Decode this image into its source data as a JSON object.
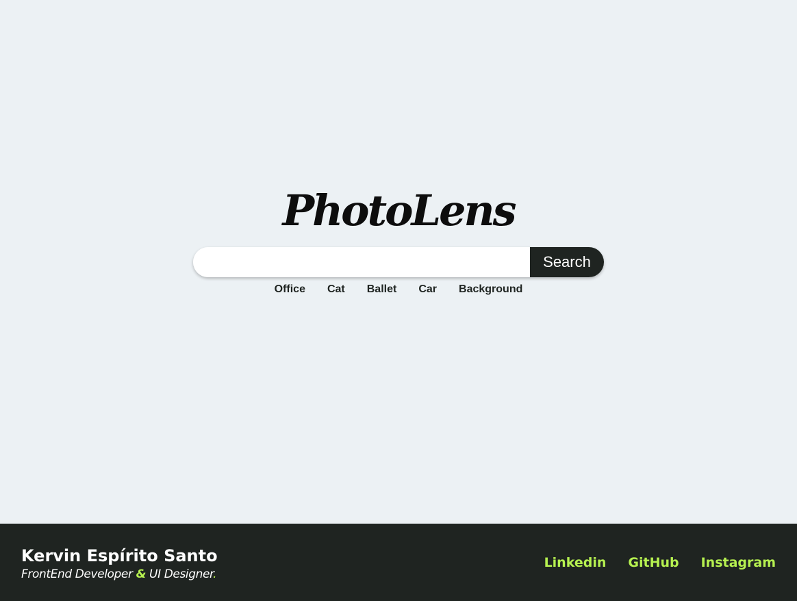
{
  "app": {
    "logo_text": "PhotoLens"
  },
  "search": {
    "input_value": "",
    "placeholder": "",
    "button_label": "Search"
  },
  "suggestions": [
    "Office",
    "Cat",
    "Ballet",
    "Car",
    "Background"
  ],
  "footer": {
    "author_name": "Kervin Espírito Santo",
    "role_part1": "FrontEnd Developer",
    "role_amp": "&",
    "role_part2": "UI Designer",
    "role_period": ".",
    "links": [
      "Linkedin",
      "GitHub",
      "Instagram"
    ]
  },
  "colors": {
    "background": "#ecf1f4",
    "dark": "#1f2421",
    "accent": "#b6f150",
    "white": "#ffffff"
  }
}
